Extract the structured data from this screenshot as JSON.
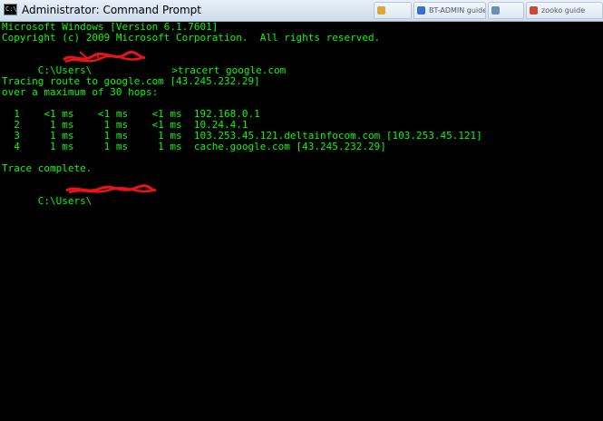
{
  "window": {
    "title": "Administrator: Command Prompt",
    "icon_glyph": "C:\\",
    "text_color": "#00ff00",
    "background_color": "#000000"
  },
  "taskbar_fragments": [
    {
      "label": "",
      "icon": "folder-icon",
      "icon_color": "#d9a93a"
    },
    {
      "label": "BT-ADMIN guide",
      "icon": "document-icon",
      "icon_color": "#3a6fc9"
    },
    {
      "label": "",
      "icon": "window-icon",
      "icon_color": "#6a8fb0"
    },
    {
      "label": "zooko guide",
      "icon": "browser-icon",
      "icon_color": "#c94a3a"
    }
  ],
  "console": {
    "lines": [
      "Microsoft Windows [Version 6.1.7601]",
      "Copyright (c) 2009 Microsoft Corporation.  All rights reserved.",
      "",
      "C:\\Users\\",
      "",
      "Tracing route to google.com [43.245.232.29]",
      "over a maximum of 30 hops:",
      "",
      "  1    <1 ms    <1 ms    <1 ms  192.168.0.1",
      "  2     1 ms     1 ms    <1 ms  10.24.4.1",
      "  3     1 ms     1 ms     1 ms  103.253.45.121.deltainfocom.com [103.253.45.121]",
      "  4     1 ms     1 ms     1 ms  cache.google.com [43.245.232.29]",
      "",
      "Trace complete.",
      "",
      "C:\\Users\\"
    ],
    "command": "tracert google.com",
    "prompt_tail": ">"
  }
}
